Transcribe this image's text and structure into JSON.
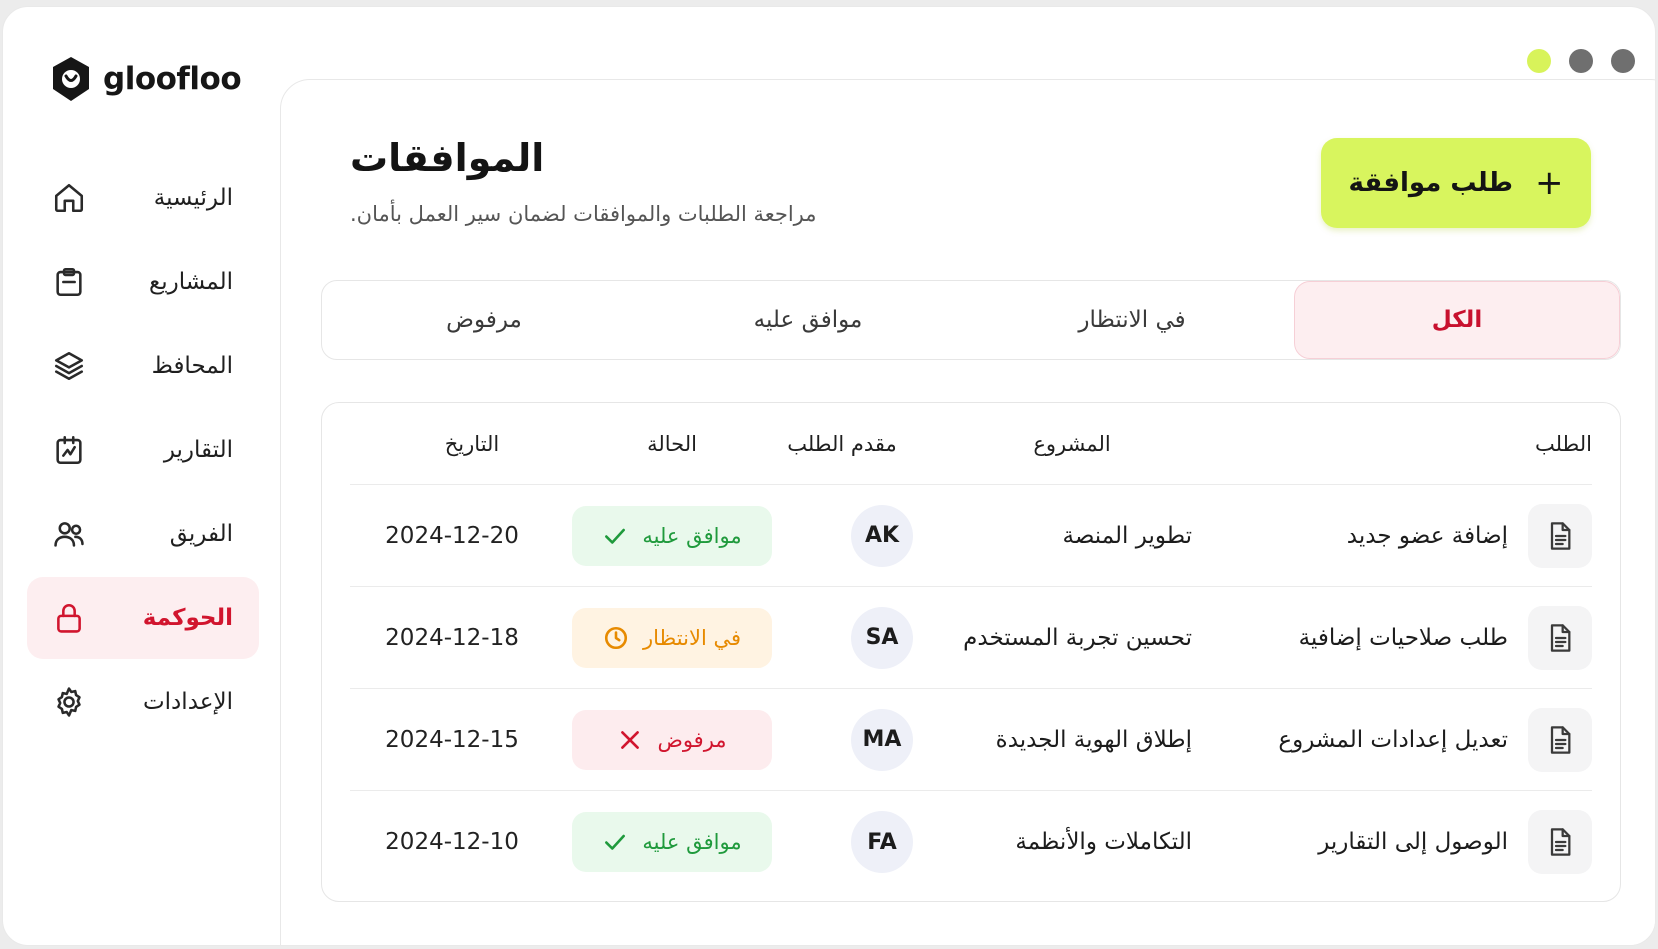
{
  "app": {
    "brand": "gloofloo"
  },
  "colors": {
    "accent": "#d8f55e",
    "active": "#d1152e",
    "approved": "#1f9a3c",
    "pending": "#e78a00",
    "rejected": "#d1152e"
  },
  "sidebar": {
    "items": [
      {
        "label": "الرئيسية",
        "icon": "home-icon"
      },
      {
        "label": "المشاريع",
        "icon": "clipboard-icon"
      },
      {
        "label": "المحافظ",
        "icon": "layers-icon"
      },
      {
        "label": "التقارير",
        "icon": "chart-icon"
      },
      {
        "label": "الفريق",
        "icon": "users-icon"
      },
      {
        "label": "الحوكمة",
        "icon": "lock-icon",
        "active": true
      },
      {
        "label": "الإعدادات",
        "icon": "gear-icon"
      }
    ]
  },
  "header": {
    "title": "الموافقات",
    "subtitle": "مراجعة الطلبات والموافقات لضمان سير العمل بأمان.",
    "new_request_label": "طلب موافقة"
  },
  "tabs": [
    {
      "label": "الكل",
      "active": true
    },
    {
      "label": "في الانتظار"
    },
    {
      "label": "موافق عليه"
    },
    {
      "label": "مرفوض"
    }
  ],
  "table": {
    "columns": {
      "request": "الطلب",
      "project": "المشروع",
      "requester": "مقدم الطلب",
      "status": "الحالة",
      "date": "التاريخ"
    },
    "rows": [
      {
        "request": "إضافة عضو جديد",
        "project": "تطوير المنصة",
        "requester": "AK",
        "status": "موافق عليه",
        "status_type": "approved",
        "date": "2024-12-20"
      },
      {
        "request": "طلب صلاحيات إضافية",
        "project": "تحسين تجربة المستخدم",
        "requester": "SA",
        "status": "في الانتظار",
        "status_type": "pending",
        "date": "2024-12-18"
      },
      {
        "request": "تعديل إعدادات المشروع",
        "project": "إطلاق الهوية الجديدة",
        "requester": "MA",
        "status": "مرفوض",
        "status_type": "rejected",
        "date": "2024-12-15"
      },
      {
        "request": "الوصول إلى التقارير",
        "project": "التكاملات والأنظمة",
        "requester": "FA",
        "status": "موافق عليه",
        "status_type": "approved",
        "date": "2024-12-10"
      }
    ]
  }
}
